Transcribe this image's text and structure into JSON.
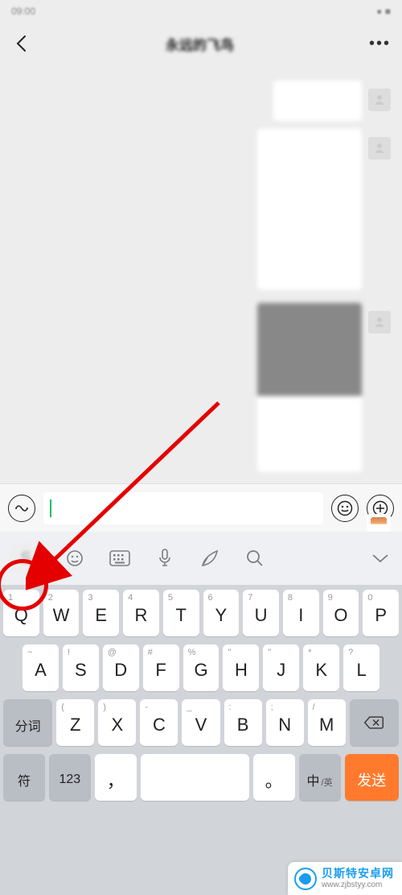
{
  "status": {
    "time": "09:00",
    "right": "● ■"
  },
  "header": {
    "title": "永远的飞鸟",
    "more": "•••"
  },
  "input": {
    "value": ""
  },
  "kb_toolbar": {
    "icons": [
      "s-icon",
      "emoji-icon",
      "keyboard-icon",
      "microphone-icon",
      "quill-icon",
      "search-icon",
      "chevron-down-icon"
    ]
  },
  "keyboard": {
    "row1": [
      {
        "n": "1",
        "k": "Q"
      },
      {
        "n": "2",
        "k": "W"
      },
      {
        "n": "3",
        "k": "E"
      },
      {
        "n": "4",
        "k": "R"
      },
      {
        "n": "5",
        "k": "T"
      },
      {
        "n": "6",
        "k": "Y"
      },
      {
        "n": "7",
        "k": "U"
      },
      {
        "n": "8",
        "k": "I"
      },
      {
        "n": "9",
        "k": "O"
      },
      {
        "n": "0",
        "k": "P"
      }
    ],
    "row2": [
      {
        "n": "~",
        "k": "A"
      },
      {
        "n": "!",
        "k": "S"
      },
      {
        "n": "@",
        "k": "D"
      },
      {
        "n": "#",
        "k": "F"
      },
      {
        "n": "%",
        "k": "G"
      },
      {
        "n": "\"",
        "k": "H"
      },
      {
        "n": "\"",
        "k": "J"
      },
      {
        "n": "*",
        "k": "K"
      },
      {
        "n": "?",
        "k": "L"
      }
    ],
    "row3": {
      "left_fn": "分词",
      "keys": [
        {
          "n": "(",
          "k": "Z"
        },
        {
          "n": ")",
          "k": "X"
        },
        {
          "n": "-",
          "k": "C"
        },
        {
          "n": "_",
          "k": "V"
        },
        {
          "n": ":",
          "k": "B"
        },
        {
          "n": ";",
          "k": "N"
        },
        {
          "n": "/",
          "k": "M"
        }
      ]
    },
    "row4": {
      "symbol": "符",
      "num": "123",
      "comma": "，",
      "space": "",
      "period": "。",
      "lang_main": "中",
      "lang_sub": "/英",
      "send": "发送"
    }
  },
  "watermark": {
    "cn": "贝斯特安卓网",
    "url": "www.zjbstyy.com"
  }
}
